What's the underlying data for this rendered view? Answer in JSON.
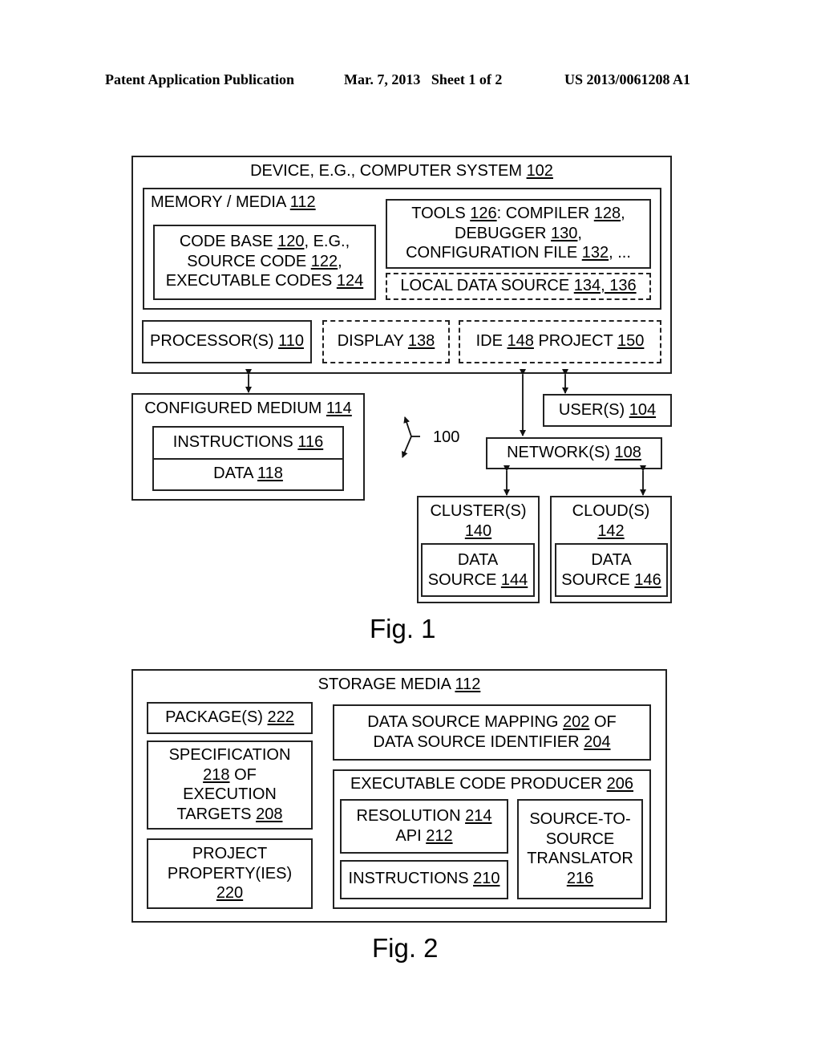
{
  "header": {
    "publication": "Patent Application Publication",
    "date_sheet": "Mar. 7, 2013   Sheet 1 of 2",
    "patent_number": "US 2013/0061208 A1"
  },
  "fig1": {
    "caption": "Fig. 1",
    "device": {
      "text": "DEVICE, E.G., COMPUTER SYSTEM ",
      "ref": "102"
    },
    "memory": {
      "text": "MEMORY / MEDIA ",
      "ref": "112"
    },
    "code_base": {
      "l1a": "CODE BASE ",
      "l1ref": "120",
      "l1b": ", E.G.,",
      "l2a": "SOURCE CODE ",
      "l2ref": "122",
      "l2b": ",",
      "l3a": "EXECUTABLE CODES ",
      "l3ref": "124"
    },
    "tools": {
      "l1a": "TOOLS ",
      "l1ref1": "126",
      "l1b": ": COMPILER ",
      "l1ref2": "128",
      "l1c": ",",
      "l2a": "DEBUGGER ",
      "l2ref": "130",
      "l2b": ",",
      "l3a": "CONFIGURATION FILE ",
      "l3ref": "132",
      "l3b": ", ..."
    },
    "local_data_source": {
      "text": "LOCAL DATA SOURCE ",
      "ref": "134, 136"
    },
    "processor": {
      "text": "PROCESSOR(S) ",
      "ref": "110"
    },
    "display": {
      "text": "DISPLAY ",
      "ref": "138"
    },
    "ide": {
      "a": "IDE ",
      "ref1": "148",
      "b": " PROJECT ",
      "ref2": "150"
    },
    "configured_medium": {
      "text": "CONFIGURED MEDIUM ",
      "ref": "114"
    },
    "instructions": {
      "text": "INSTRUCTIONS ",
      "ref": "116"
    },
    "data": {
      "text": "DATA ",
      "ref": "118"
    },
    "system_ref": "100",
    "users": {
      "text": "USER(S) ",
      "ref": "104"
    },
    "network": {
      "text": "NETWORK(S) ",
      "ref": "108"
    },
    "cluster": {
      "text": "CLUSTER(S)",
      "ref": "140"
    },
    "cluster_ds": {
      "l1": "DATA",
      "l2": "SOURCE ",
      "ref": "144"
    },
    "cloud": {
      "text": "CLOUD(S)",
      "ref": "142"
    },
    "cloud_ds": {
      "l1": "DATA",
      "l2": "SOURCE ",
      "ref": "146"
    }
  },
  "fig2": {
    "caption": "Fig. 2",
    "storage": {
      "text": "STORAGE MEDIA ",
      "ref": "112"
    },
    "packages": {
      "text": "PACKAGE(S) ",
      "ref": "222"
    },
    "specification": {
      "l1": "SPECIFICATION",
      "l2ref": "218",
      "l2b": " OF",
      "l3": "EXECUTION",
      "l4a": "TARGETS ",
      "l4ref": "208"
    },
    "project_property": {
      "l1": "PROJECT",
      "l2": "PROPERTY(IES)",
      "ref": "220"
    },
    "mapping": {
      "l1a": "DATA SOURCE MAPPING ",
      "l1ref": "202",
      "l1b": " OF",
      "l2a": "DATA SOURCE IDENTIFIER ",
      "l2ref": "204"
    },
    "producer": {
      "text": "EXECUTABLE CODE PRODUCER ",
      "ref": "206"
    },
    "resolution": {
      "l1a": "RESOLUTION ",
      "l1ref": "214",
      "l2a": "API ",
      "l2ref": "212"
    },
    "instructions": {
      "text": "INSTRUCTIONS ",
      "ref": "210"
    },
    "translator": {
      "l1": "SOURCE-TO-",
      "l2": "SOURCE",
      "l3": "TRANSLATOR",
      "ref": "216"
    }
  }
}
